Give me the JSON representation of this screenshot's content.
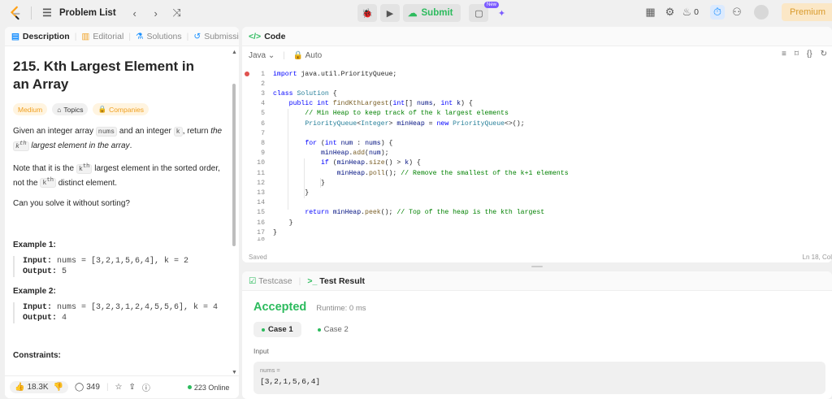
{
  "topbar": {
    "problem_list": "Problem List",
    "submit": "Submit",
    "new_badge": "New",
    "streak": "0",
    "premium": "Premium"
  },
  "left_tabs": [
    "Description",
    "Editorial",
    "Solutions",
    "Submissions"
  ],
  "problem": {
    "title": "215. Kth Largest Element in an Array",
    "difficulty": "Medium",
    "topics": "Topics",
    "companies": "Companies",
    "p1_a": "Given an integer array ",
    "p1_code1": "nums",
    "p1_b": " and an integer ",
    "p1_code2": "k",
    "p1_c": ", return ",
    "p1_d": "the ",
    "p1_code3": "k",
    "p1_sup1": "th",
    "p1_e": " largest element in the array",
    "p1_f": ".",
    "p2_a": "Note that it is the ",
    "p2_code": "k",
    "p2_sup": "th",
    "p2_b": " largest element in the sorted order, not the ",
    "p2_code2": "k",
    "p2_sup2": "th",
    "p2_c": " distinct element.",
    "p3": "Can you solve it without sorting?",
    "ex1_h": "Example 1:",
    "ex1_in_label": "Input:",
    "ex1_in": " nums = [3,2,1,5,6,4], k = 2",
    "ex1_out_label": "Output:",
    "ex1_out": " 5",
    "ex2_h": "Example 2:",
    "ex2_in_label": "Input:",
    "ex2_in": " nums = [3,2,3,1,2,4,5,5,6], k = 4",
    "ex2_out_label": "Output:",
    "ex2_out": " 4",
    "constraints": "Constraints:"
  },
  "bottombar": {
    "likes": "18.3K",
    "comments": "349",
    "online": "223 Online"
  },
  "code_panel": {
    "tab": "Code",
    "language": "Java",
    "auto": "Auto",
    "saved": "Saved",
    "cursor": "Ln 18, Col"
  },
  "code_lines": [
    "import java.util.PriorityQueue;",
    "",
    "class Solution {",
    "    public int findKthLargest(int[] nums, int k) {",
    "        // Min Heap to keep track of the k largest elements",
    "        PriorityQueue<Integer> minHeap = new PriorityQueue<>();",
    "",
    "        for (int num : nums) {",
    "            minHeap.add(num);",
    "            if (minHeap.size() > k) {",
    "                minHeap.poll(); // Remove the smallest of the k+1 elements",
    "            }",
    "        }",
    "",
    "        return minHeap.peek(); // Top of the heap is the kth largest",
    "    }",
    "}",
    ""
  ],
  "test_panel": {
    "tab_testcase": "Testcase",
    "tab_result": "Test Result",
    "status": "Accepted",
    "runtime": "Runtime: 0 ms",
    "case1": "Case 1",
    "case2": "Case 2",
    "input_label": "Input",
    "input_key": "nums =",
    "input_val": "[3,2,1,5,6,4]"
  },
  "icons": [
    "logo-icon",
    "list-icon",
    "chevron-left-icon",
    "chevron-right-icon",
    "shuffle-icon",
    "debug-icon",
    "play-icon",
    "upload-icon",
    "note-icon",
    "sparkle-icon",
    "grid-icon",
    "settings-icon",
    "fire-icon",
    "timer-icon",
    "add-user-icon"
  ],
  "colors": {
    "accent_green": "#2cbb5d",
    "medium": "#f0a020",
    "premium": "#d99a2b"
  }
}
